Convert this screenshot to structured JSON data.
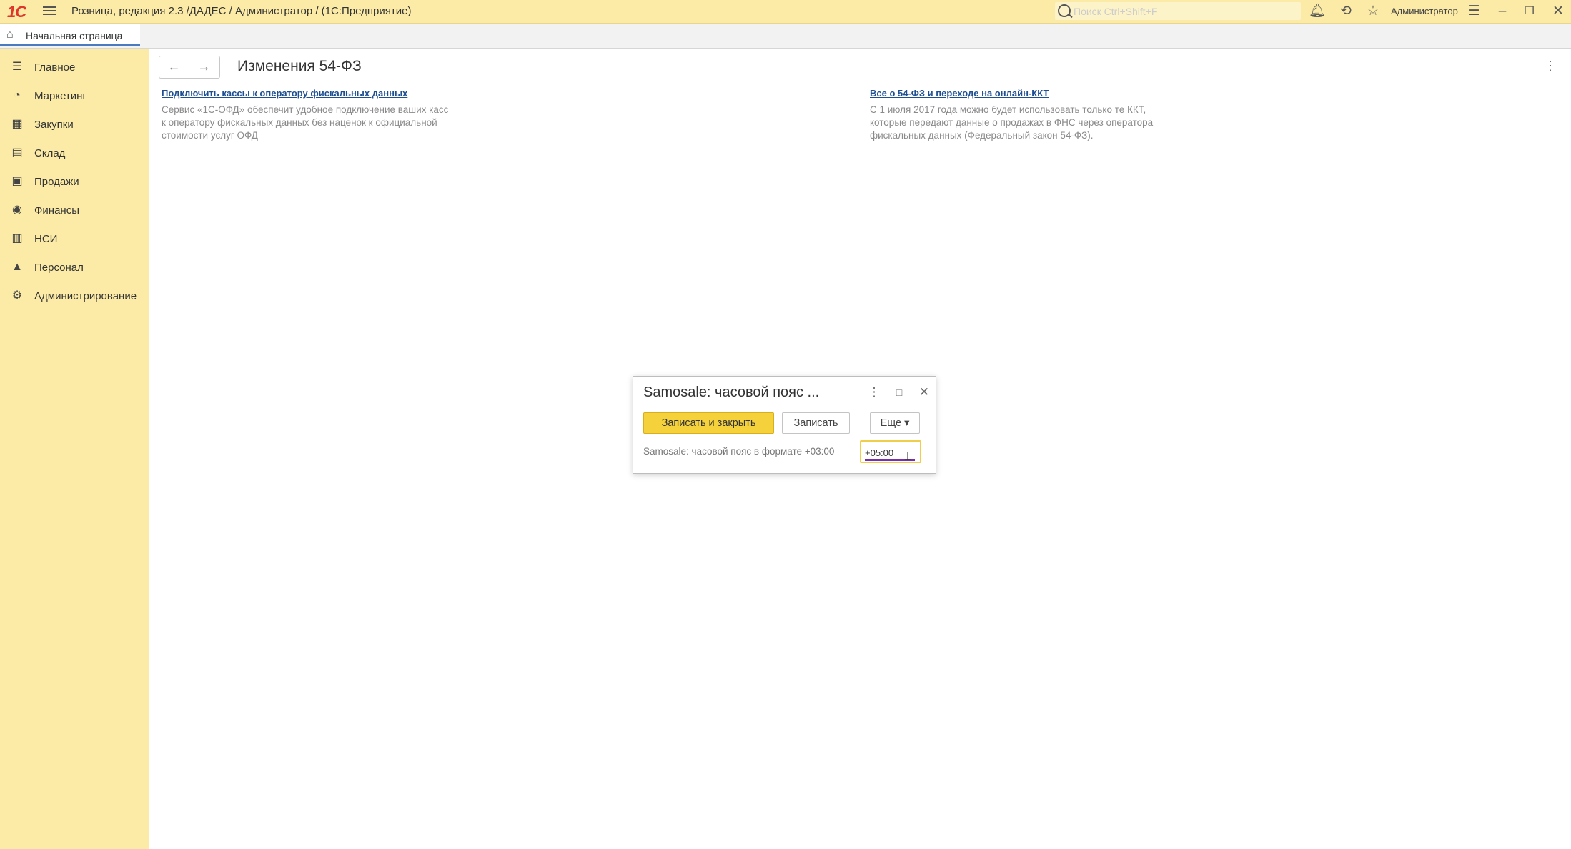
{
  "titlebar": {
    "logo": "1С",
    "app_title": "Розница, редакция 2.3 /ДАДЕС / Администратор / (1С:Предприятие)",
    "search_placeholder": "Поиск Ctrl+Shift+F",
    "user": "Администратор"
  },
  "tabs": {
    "home_label": "Начальная страница"
  },
  "sidebar": {
    "items": [
      {
        "label": "Главное",
        "icon": "menu-lines-icon"
      },
      {
        "label": "Маркетинг",
        "icon": "pie-chart-icon"
      },
      {
        "label": "Закупки",
        "icon": "cart-icon"
      },
      {
        "label": "Склад",
        "icon": "warehouse-grid-icon"
      },
      {
        "label": "Продажи",
        "icon": "shopping-bag-icon"
      },
      {
        "label": "Финансы",
        "icon": "coins-icon"
      },
      {
        "label": "НСИ",
        "icon": "books-icon"
      },
      {
        "label": "Персонал",
        "icon": "person-icon"
      },
      {
        "label": "Администрирование",
        "icon": "gear-icon"
      }
    ]
  },
  "main": {
    "title": "Изменения 54-ФЗ",
    "left_link": "Подключить кассы к оператору фискальных данных",
    "left_desc": [
      "Сервис «1С-ОФД» обеспечит удобное подключение ваших касс",
      "к оператору фискальных данных без наценок к официальной",
      "стоимости услуг ОФД"
    ],
    "right_link": "Все о 54-ФЗ и переходе на онлайн-ККТ",
    "right_desc": [
      "С 1 июля 2017 года можно будет использовать только те ККТ,",
      "которые передают данные о продажах в ФНС через оператора",
      "фискальных данных (Федеральный закон 54-ФЗ)."
    ]
  },
  "dialog": {
    "title": "Samosale: часовой пояс ...",
    "save_close": "Записать и закрыть",
    "save": "Записать",
    "more": "Еще ▾",
    "field_label": "Samosale: часовой пояс в формате +03:00",
    "field_value": "+05:00"
  },
  "colors": {
    "panel_yellow": "#fbeba6",
    "primary_button": "#f5d13b",
    "link_blue": "#1d4f91"
  }
}
